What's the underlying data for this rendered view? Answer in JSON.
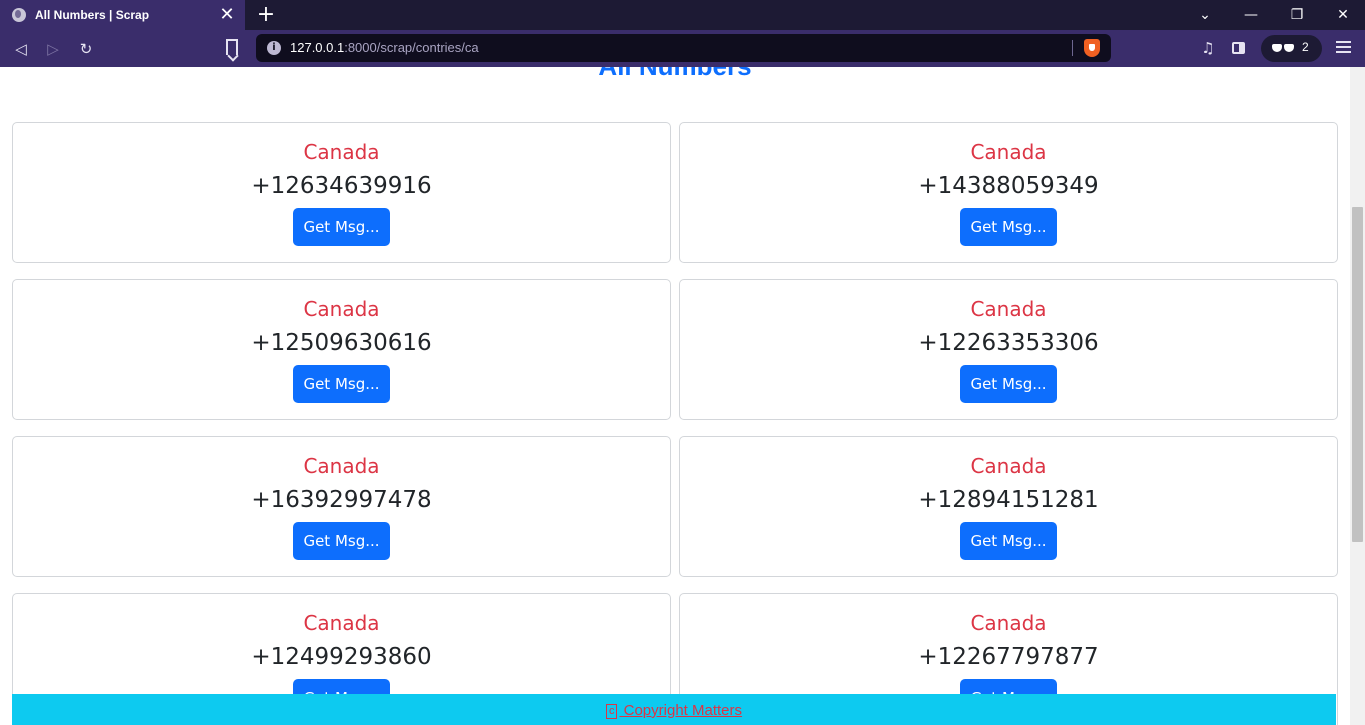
{
  "browser": {
    "tab_title": "All Numbers | Scrap",
    "url_host": "127.0.0.1",
    "url_rest": ":8000/scrap/contries/ca",
    "profile_count": "2"
  },
  "page": {
    "heading": "All Numbers",
    "cards": [
      {
        "country": "Canada",
        "number": "+12634639916",
        "button": "Get Msg..."
      },
      {
        "country": "Canada",
        "number": "+14388059349",
        "button": "Get Msg..."
      },
      {
        "country": "Canada",
        "number": "+12509630616",
        "button": "Get Msg..."
      },
      {
        "country": "Canada",
        "number": "+12263353306",
        "button": "Get Msg..."
      },
      {
        "country": "Canada",
        "number": "+16392997478",
        "button": "Get Msg..."
      },
      {
        "country": "Canada",
        "number": "+12894151281",
        "button": "Get Msg..."
      },
      {
        "country": "Canada",
        "number": "+12499293860",
        "button": "Get Msg..."
      },
      {
        "country": "Canada",
        "number": "+12267797877",
        "button": "Get Msg..."
      }
    ],
    "footer": {
      "copyright_symbol": "c",
      "text": " Copyright Matters"
    }
  },
  "colors": {
    "accent": "#0d6efd",
    "country_text": "#dc3545",
    "footer_bg": "#0dcaf0",
    "chrome_bg": "#3a2d6b"
  }
}
